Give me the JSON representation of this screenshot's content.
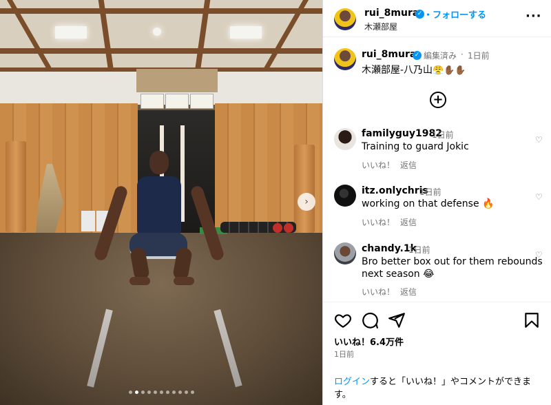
{
  "post": {
    "username": "rui_8mura",
    "follow_label": "・フォローする",
    "location": "木瀬部屋",
    "more_icon": "more-options-icon"
  },
  "caption": {
    "username": "rui_8mura",
    "edited_label": "編集済み",
    "time": "1日前",
    "text": "木瀬部屋-八乃山",
    "emojis": "😤✋🏾✋🏾"
  },
  "add_icon": "plus-circle-icon",
  "comments": [
    {
      "username": "familyguy1982",
      "time": "1日前",
      "text": "Training to guard Jokic",
      "like_label": "いいね！",
      "reply_label": "返信"
    },
    {
      "username": "itz.onlychris",
      "time": "1日前",
      "text": "working on that defense 🔥",
      "like_label": "いいね！",
      "reply_label": "返信"
    },
    {
      "username": "chandy.1k",
      "time": "1日前",
      "text_line1": "Bro better box out for them rebounds",
      "text_line2": "next season 😂",
      "like_label": "いいね！",
      "reply_label": "返信"
    }
  ],
  "actions": {
    "icons": [
      "heart-icon",
      "comment-icon",
      "share-icon",
      "bookmark-icon"
    ],
    "likes_label": "いいね！6.4万件",
    "time": "1日前",
    "login_link": "ログイン",
    "login_rest_line1": "すると「いいね！」やコメントができま",
    "login_rest_line2": "す。"
  },
  "carousel": {
    "next_icon": "chevron-right-icon",
    "dots_count": 11,
    "active_index": 1
  },
  "colors": {
    "accent": "#0095f6",
    "muted": "#737373",
    "border": "#dbdbdb"
  }
}
